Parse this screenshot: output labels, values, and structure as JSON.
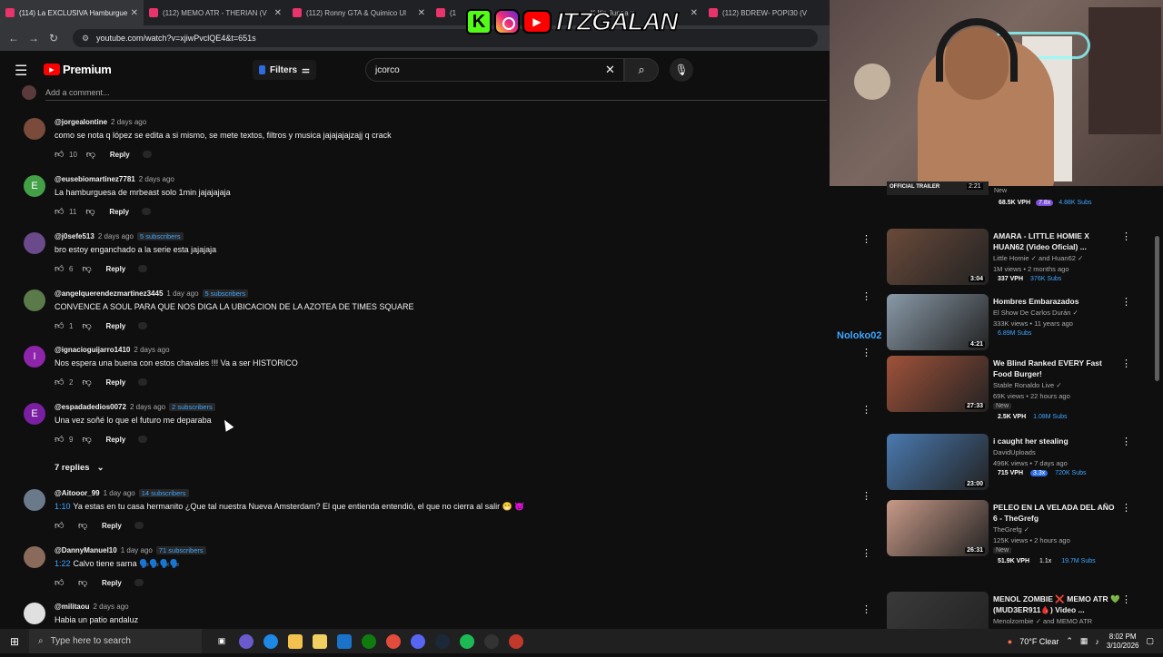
{
  "browser": {
    "tabs": [
      {
        "label": "(114) La EXCLUSIVA Hamburguesa",
        "active": true
      },
      {
        "label": "(112) MEMO ATR - THERIAN (V",
        "active": false
      },
      {
        "label": "(112) Ronny GTA & Quimico Ul",
        "active": false
      },
      {
        "label": "(1",
        "active": false
      },
      {
        "label": "K It's Junaa x",
        "active": false
      },
      {
        "label": "(112) BDREW- POPI30 (VIL",
        "active": false
      }
    ],
    "url": "youtube.com/watch?v=xjiwPvclQE4&t=651s"
  },
  "overlay": {
    "name": "ITZGALAN",
    "kick": "K"
  },
  "header": {
    "brand": "Premium",
    "filters_label": "Filters",
    "search_value": "jcorco"
  },
  "comments_section": {
    "add_comment_placeholder": "Add a comment...",
    "reply_label": "Reply",
    "replies_toggle": "7 replies",
    "comments": [
      {
        "author": "@jorgealontine",
        "time": "2 days ago",
        "subs": "",
        "ts": "",
        "text": "como se nota q lópez se edita a si mismo, se mete textos, filtros y musica jajajajajzajj q crack",
        "likes": "10",
        "avatar": "",
        "avatar_color": "#7a4a3a"
      },
      {
        "author": "@eusebiomartinez7781",
        "time": "2 days ago",
        "subs": "",
        "ts": "",
        "text": "La hamburguesa de mrbeast solo 1min jajajajaja",
        "likes": "11",
        "avatar": "E",
        "avatar_color": "#43a047"
      },
      {
        "author": "@j0sefe513",
        "time": "2 days ago",
        "subs": "5 subscribers",
        "ts": "",
        "text": "bro estoy enganchado a la serie esta jajajaja",
        "likes": "6",
        "avatar": "",
        "avatar_color": "#6a4a8a"
      },
      {
        "author": "@angelquerendezmartinez3445",
        "time": "1 day ago",
        "subs": "5 subscribers",
        "ts": "",
        "text": "CONVENCE A SOUL PARA QUE NOS DIGA LA UBICACION DE LA AZOTEA DE TIMES SQUARE",
        "likes": "1",
        "avatar": "",
        "avatar_color": "#5a7a4a"
      },
      {
        "author": "@ignacioguijarro1410",
        "time": "2 days ago",
        "subs": "",
        "ts": "",
        "text": "Nos espera una buena con estos chavales !!! Va a ser HISTORICO",
        "likes": "2",
        "avatar": "I",
        "avatar_color": "#8e24aa"
      },
      {
        "author": "@espadadedios0072",
        "time": "2 days ago",
        "subs": "2 subscribers",
        "ts": "",
        "text": "Una vez soñé lo que el futuro me deparaba",
        "likes": "9",
        "avatar": "E",
        "avatar_color": "#7b1fa2"
      },
      {
        "author": "@Aitooor_99",
        "time": "1 day ago",
        "subs": "14 subscribers",
        "ts": "1:10",
        "text": "Ya estas en tu casa hermanito ¿Que tal nuestra Nueva Amsterdam? El que entienda entendió, el que no cierra al salir 😁 😈",
        "likes": "",
        "avatar": "",
        "avatar_color": "#6a7a8a"
      },
      {
        "author": "@DannyManuel10",
        "time": "1 day ago",
        "subs": "71 subscribers",
        "ts": "1:22",
        "text": "Calvo tiene sarna 🗣️🗣️🗣️🗣️",
        "likes": "",
        "avatar": "",
        "avatar_color": "#8a6a5a"
      },
      {
        "author": "@militaou",
        "time": "2 days ago",
        "subs": "",
        "ts": "",
        "text": "Habia un patio andaluz",
        "likes": "",
        "avatar": "",
        "avatar_color": "#e0e0e0"
      }
    ]
  },
  "sidebar": {
    "partial": {
      "thumb_text": "OFFICIAL TRAILER",
      "duration": "2:21",
      "badge": "New",
      "vph": "68.5K VPH",
      "mult": "7.8x",
      "subs": "4.88K Subs"
    },
    "floating_user": "Noloko02",
    "videos": [
      {
        "title": "AMARA - LITTLE HOMIE X HUAN62 (Video Oficial) ...",
        "channel": "Little Homie ✓ and Huan62 ✓",
        "views": "1M views • 2 months ago",
        "badge": "",
        "vph": "337 VPH",
        "mult": "",
        "subs": "376K Subs",
        "duration": "3:04",
        "thumb_color": "#6a4a3a"
      },
      {
        "title": "Hombres Embarazados",
        "channel": "El Show De Carlos Durán ✓",
        "views": "333K views • 11 years ago",
        "badge": "",
        "vph": "",
        "mult": "",
        "subs": "6.89M Subs",
        "duration": "4:21",
        "thumb_color": "#8a9aa8"
      },
      {
        "title": "We Blind Ranked EVERY Fast Food Burger!",
        "channel": "Stable Ronaldo Live ✓",
        "views": "69K views • 22 hours ago",
        "badge": "New",
        "vph": "2.5K VPH",
        "mult": "",
        "subs": "1.08M Subs",
        "duration": "27:33",
        "thumb_color": "#a0523a"
      },
      {
        "title": "i caught her stealing",
        "channel": "DavidUploads",
        "views": "496K views • 7 days ago",
        "badge": "",
        "vph": "715 VPH",
        "mult": "3.3x",
        "subs": "720K Subs",
        "duration": "23:00",
        "thumb_color": "#4a7ab0"
      },
      {
        "title": "PELEO EN LA VELADA DEL AÑO 6 - TheGrefg",
        "channel": "TheGrefg ✓",
        "views": "125K views • 2 hours ago",
        "badge": "New",
        "vph": "51.9K VPH",
        "mult": "1.1x",
        "subs": "19.7M Subs",
        "duration": "26:31",
        "thumb_color": "#c89a88"
      },
      {
        "title": "MENOL ZOMBIE ❌ MEMO ATR 💚 (MUD3ER911🩸) Video ...",
        "channel": "Menolzombie ✓ and MEMO ATR",
        "views": "",
        "badge": "",
        "vph": "",
        "mult": "",
        "subs": "",
        "duration": "",
        "thumb_color": "#3a3a3a"
      }
    ]
  },
  "taskbar": {
    "search_placeholder": "Type here to search",
    "weather": "70°F Clear",
    "time": "8:02 PM",
    "date": "3/10/2026"
  },
  "colors": {
    "yt_red": "#ff0000",
    "link_blue": "#3ea6ff",
    "bg": "#0f0f0f"
  }
}
